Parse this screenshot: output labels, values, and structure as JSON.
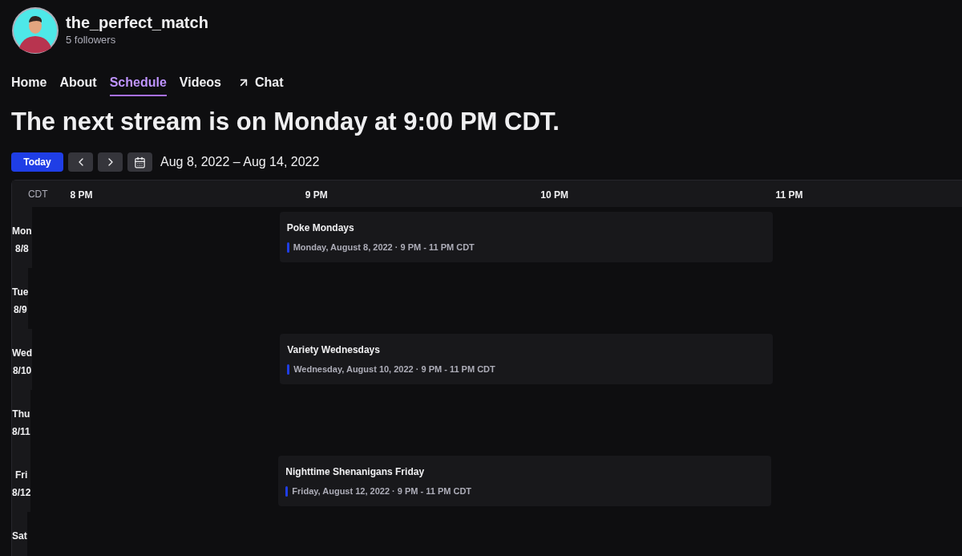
{
  "channel": {
    "name": "the_perfect_match",
    "followers": "5 followers"
  },
  "nav": [
    {
      "label": "Home",
      "selected": false,
      "kind": "link"
    },
    {
      "label": "About",
      "selected": false,
      "kind": "link"
    },
    {
      "label": "Schedule",
      "selected": true,
      "kind": "link"
    },
    {
      "label": "Videos",
      "selected": false,
      "kind": "link"
    },
    {
      "label": "Chat",
      "selected": false,
      "kind": "external"
    }
  ],
  "headline": "The next stream is on Monday at 9:00 PM CDT.",
  "toolbar": {
    "today": "Today",
    "range": "Aug 8, 2022 – Aug 14, 2022"
  },
  "calendar": {
    "timezone": "CDT",
    "hours": [
      "8 PM",
      "9 PM",
      "10 PM",
      "11 PM"
    ],
    "days": [
      {
        "day": "Mon",
        "date": "8/8",
        "event": {
          "title": "Poke Mondays",
          "detail": "Monday, August 8, 2022 · 9 PM - 11 PM CDT"
        }
      },
      {
        "day": "Tue",
        "date": "8/9"
      },
      {
        "day": "Wed",
        "date": "8/10",
        "event": {
          "title": "Variety Wednesdays",
          "detail": "Wednesday, August 10, 2022 · 9 PM - 11 PM CDT"
        }
      },
      {
        "day": "Thu",
        "date": "8/11"
      },
      {
        "day": "Fri",
        "date": "8/12",
        "event": {
          "title": "Nighttime Shenanigans Friday",
          "detail": "Friday, August 12, 2022 · 9 PM - 11 PM CDT"
        }
      },
      {
        "day": "Sat"
      }
    ]
  }
}
